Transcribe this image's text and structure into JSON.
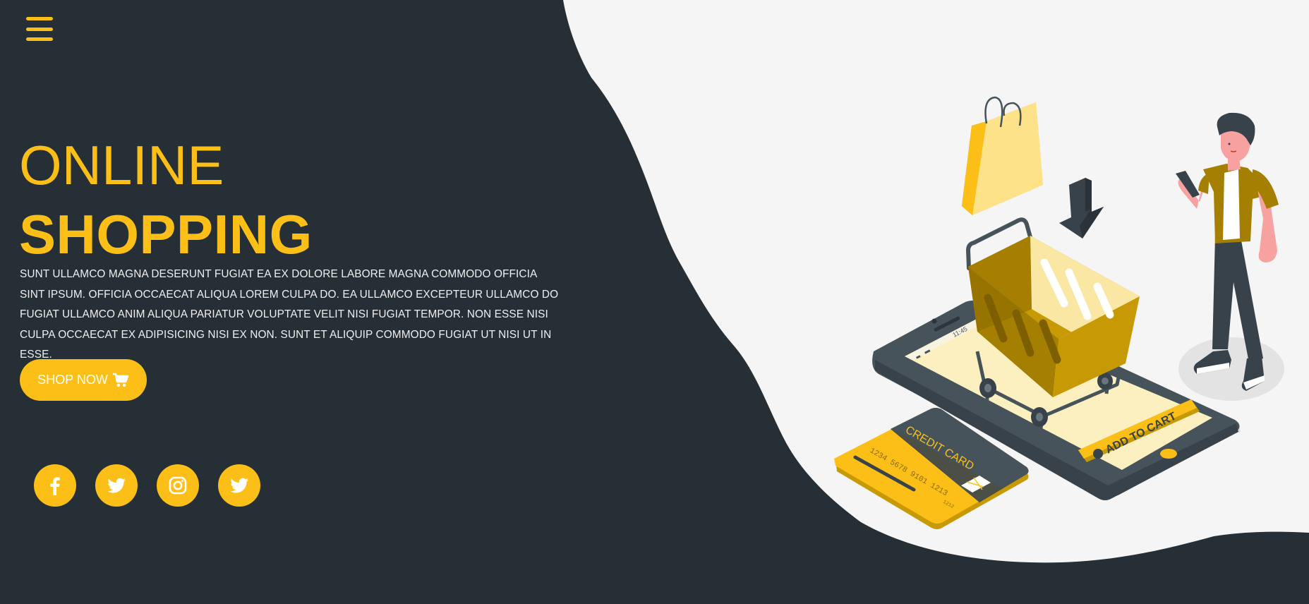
{
  "nav": {
    "menu_icon": "hamburger-icon"
  },
  "hero": {
    "title_line1": "ONLINE",
    "title_line2": "SHOPPING",
    "description": "SUNT ULLAMCO MAGNA DESERUNT FUGIAT EA EX DOLORE LABORE MAGNA COMMODO OFFICIA SINT IPSUM. OFFICIA OCCAECAT ALIQUA LOREM CULPA DO. EA ULLAMCO EXCEPTEUR ULLAMCO DO FUGIAT ULLAMCO ANIM ALIQUA PARIATUR VOLUPTATE VELIT NISI FUGIAT TEMPOR. NON ESSE NISI CULPA OCCAECAT EX ADIPISICING NISI EX NON. SUNT ET ALIQUIP COMMODO FUGIAT UT NISI UT IN ESSE.",
    "button_label": "SHOP NOW",
    "button_icon": "cart-icon"
  },
  "socials": [
    {
      "name": "facebook",
      "icon": "facebook-icon"
    },
    {
      "name": "twitter",
      "icon": "twitter-icon"
    },
    {
      "name": "instagram",
      "icon": "instagram-icon"
    },
    {
      "name": "twitter",
      "icon": "twitter-icon"
    }
  ],
  "illustration": {
    "card_label": "CREDIT CARD",
    "card_number": "1234 5678 9101 1213",
    "card_small": "1212",
    "phone_time": "11:45",
    "phone_button": "ADD TO CART"
  },
  "colors": {
    "background": "#252f35",
    "accent": "#fbbf17",
    "panel": "#f5f5f5",
    "text": "#eef0f1"
  }
}
